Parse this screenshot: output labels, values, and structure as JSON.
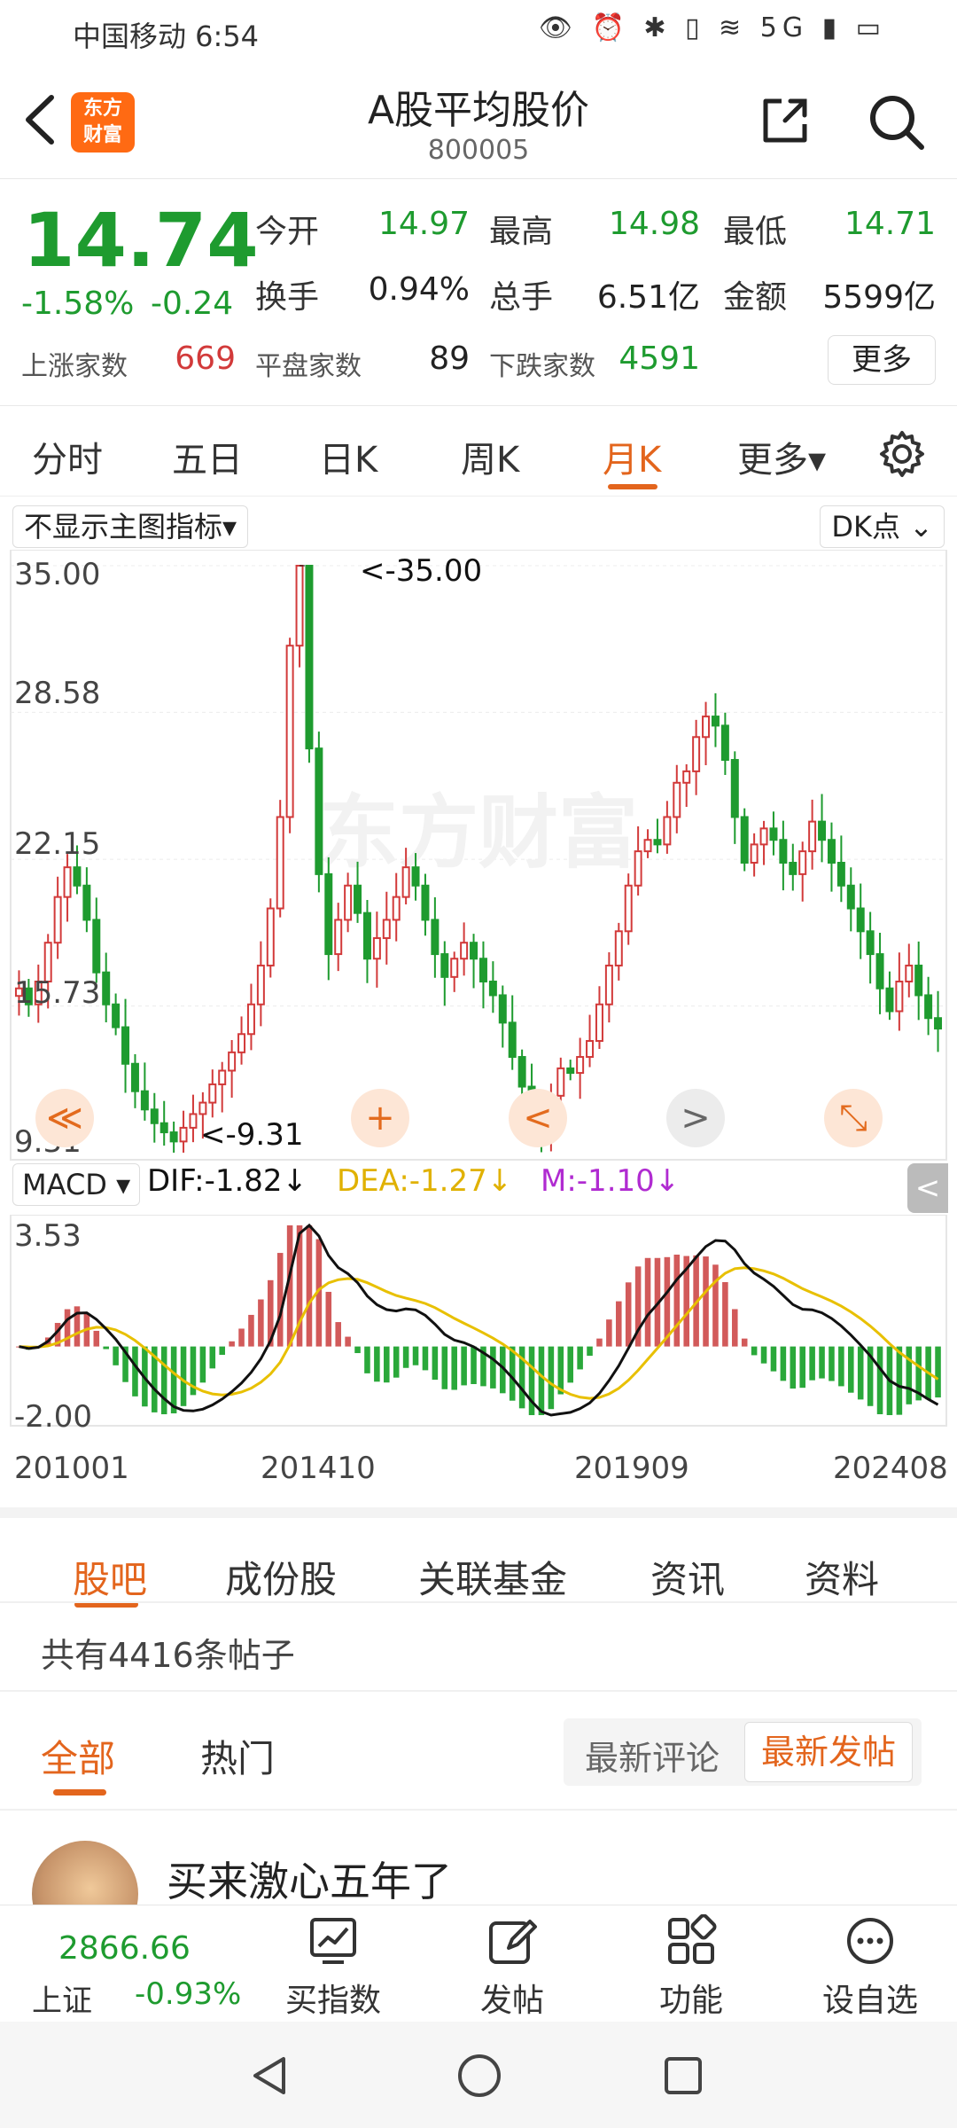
{
  "status_bar": {
    "carrier_time": "中国移动 6:54",
    "icons": "👁 ⏰ ✱ ▯ ≋ 5G ▮ ▭"
  },
  "header": {
    "logo_text_1": "东方",
    "logo_text_2": "财富",
    "title": "A股平均股价",
    "code": "800005"
  },
  "quote": {
    "price": "14.74",
    "change_pct": "-1.58%",
    "change_abs": "-0.24",
    "fields": [
      {
        "label": "今开",
        "value": "14.97",
        "color": "#1e9b2f"
      },
      {
        "label": "最高",
        "value": "14.98",
        "color": "#1e9b2f"
      },
      {
        "label": "最低",
        "value": "14.71",
        "color": "#1e9b2f"
      },
      {
        "label": "换手",
        "value": "0.94%",
        "color": "#222222"
      },
      {
        "label": "总手",
        "value": "6.51亿",
        "color": "#222222"
      },
      {
        "label": "金额",
        "value": "5599亿",
        "color": "#222222"
      }
    ],
    "breadth": [
      {
        "label": "上涨家数",
        "value": "669",
        "color": "#d23a3a"
      },
      {
        "label": "平盘家数",
        "value": "89",
        "color": "#222222"
      },
      {
        "label": "下跌家数",
        "value": "4591",
        "color": "#1e9b2f"
      }
    ],
    "more_label": "更多"
  },
  "period_tabs": [
    "分时",
    "五日",
    "日K",
    "周K",
    "月K",
    "更多▾"
  ],
  "chart": {
    "indicator_select": "不显示主图指标▾",
    "dk_label": "DK点 ⌄",
    "watermark": "东方财富",
    "y_ticks": [
      "35.00",
      "28.58",
      "22.15",
      "15.73",
      "9.31"
    ],
    "max_label": "<-35.00",
    "min_label": "<-9.31",
    "macd_select": "MACD ▾",
    "dif": "DIF:-1.82↓",
    "dea": "DEA:-1.27↓",
    "m": "M:-1.10↓",
    "macd_top": "3.53",
    "macd_bottom": "-2.00",
    "x_ticks": [
      "201001",
      "201410",
      "201909",
      "202408"
    ],
    "controls": [
      "≪",
      "+",
      "<",
      ">",
      "⤡"
    ],
    "collapse": "<"
  },
  "chart_data": {
    "type": "candlestick-monthly",
    "ylim": [
      9.31,
      35.0
    ],
    "high_marker": 35.0,
    "low_marker": 9.31,
    "x_ticks": [
      "201001",
      "201410",
      "201909",
      "202408"
    ],
    "price_path": [
      16.5,
      15.8,
      16.8,
      18.5,
      20.5,
      21.8,
      21.0,
      19.5,
      17.2,
      15.8,
      14.8,
      13.2,
      12.0,
      11.2,
      10.6,
      10.2,
      9.8,
      10.4,
      11.0,
      11.5,
      12.3,
      12.9,
      13.7,
      14.5,
      15.8,
      17.5,
      20.0,
      24.0,
      31.5,
      35.0,
      27.0,
      21.5,
      18.0,
      19.5,
      21.0,
      19.8,
      17.8,
      18.7,
      19.5,
      20.5,
      21.8,
      21.0,
      19.5,
      18.0,
      17.0,
      17.8,
      18.5,
      17.8,
      16.8,
      16.2,
      15.0,
      13.5,
      12.2,
      11.0,
      10.5,
      11.8,
      13.0,
      12.8,
      13.5,
      14.2,
      15.8,
      17.5,
      19.0,
      21.0,
      22.5,
      23.0,
      22.8,
      24.0,
      25.5,
      26.0,
      27.5,
      28.4,
      28.0,
      26.5,
      24.0,
      22.0,
      22.8,
      23.5,
      23.0,
      22.0,
      21.5,
      22.5,
      23.8,
      23.0,
      22.0,
      21.0,
      20.0,
      19.0,
      18.0,
      16.5,
      15.5,
      16.8,
      17.5,
      16.2,
      15.2,
      14.74
    ],
    "macd_ylim": [
      -2.0,
      3.53
    ],
    "dif_last": -1.82,
    "dea_last": -1.27,
    "m_last": -1.1
  },
  "content_tabs": [
    "股吧",
    "成份股",
    "关联基金",
    "资讯",
    "资料"
  ],
  "posts": {
    "count_text": "共有4416条帖子",
    "sub_tabs": [
      "全部",
      "热门"
    ],
    "sort": [
      "最新评论",
      "最新发帖"
    ],
    "first_post_title": "买来激心五年了"
  },
  "bottom_bar": {
    "index_value": "2866.66",
    "index_name": "上证",
    "index_change": "-0.93%",
    "items": [
      "买指数",
      "发帖",
      "功能",
      "设自选"
    ]
  }
}
